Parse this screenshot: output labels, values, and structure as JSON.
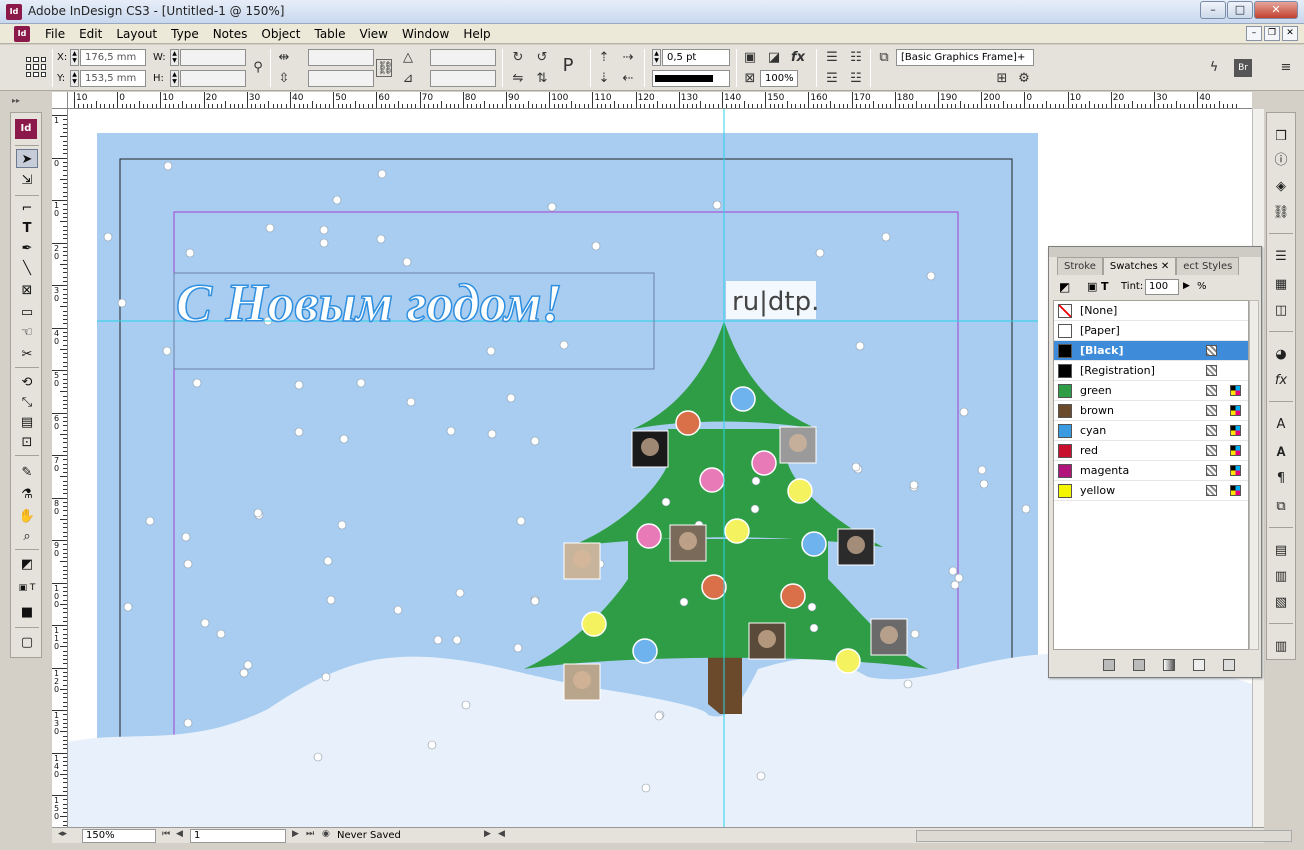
{
  "window": {
    "title": "Adobe InDesign CS3 - [Untitled-1 @ 150%]",
    "app_icon": "Id",
    "min_label": "–",
    "max_label": "□",
    "close_label": "✕"
  },
  "menubar": {
    "items": [
      "File",
      "Edit",
      "Layout",
      "Type",
      "Notes",
      "Object",
      "Table",
      "View",
      "Window",
      "Help"
    ],
    "doc_min": "–",
    "doc_restore": "❐",
    "doc_close": "✕"
  },
  "control": {
    "x_label": "X:",
    "x_value": "176,5 mm",
    "y_label": "Y:",
    "y_value": "153,5 mm",
    "w_label": "W:",
    "w_value": "",
    "h_label": "H:",
    "h_value": "",
    "stroke_weight": "0,5 pt",
    "zoom_percent": "100%",
    "object_style": "[Basic Graphics Frame]+"
  },
  "rulers": {
    "h_labels": [
      "10",
      "0",
      "10",
      "20",
      "30",
      "40",
      "50",
      "60",
      "70",
      "80",
      "90",
      "100",
      "110",
      "120",
      "130",
      "140",
      "150",
      "160",
      "170",
      "180",
      "190",
      "200",
      "0",
      "10",
      "20",
      "30",
      "40"
    ],
    "v_labels": [
      "1",
      "0",
      "1 0",
      "2 0",
      "3 0",
      "4 0",
      "5 0",
      "6 0",
      "7 0",
      "8 0",
      "9 0",
      "1 0 0",
      "1 1 0",
      "1 2 0",
      "1 3 0",
      "1 4 0",
      "1 5 0"
    ]
  },
  "document": {
    "headline": "С Новым годом!",
    "logo_text": "ru|dtp."
  },
  "swatches_panel": {
    "tabs": [
      "Stroke",
      "Swatches",
      "ect Styles"
    ],
    "close_label": "✕",
    "tint_label": "Tint:",
    "tint_value": "100",
    "tint_unit": "%",
    "items": [
      {
        "name": "[None]",
        "color": "#ffffff",
        "selected": false
      },
      {
        "name": "[Paper]",
        "color": "#ffffff",
        "selected": false
      },
      {
        "name": "[Black]",
        "color": "#000000",
        "selected": true
      },
      {
        "name": "[Registration]",
        "color": "#000000",
        "selected": false
      },
      {
        "name": "green",
        "color": "#2e9d45",
        "selected": false
      },
      {
        "name": "brown",
        "color": "#6b4a2c",
        "selected": false
      },
      {
        "name": "cyan",
        "color": "#3a9be0",
        "selected": false
      },
      {
        "name": "red",
        "color": "#c8102e",
        "selected": false
      },
      {
        "name": "magenta",
        "color": "#b0147a",
        "selected": false
      },
      {
        "name": "yellow",
        "color": "#f5f500",
        "selected": false
      }
    ]
  },
  "statusbar": {
    "zoom": "150%",
    "page": "1",
    "save_status": "Never Saved"
  },
  "colors": {
    "sky": "#a8cdf0",
    "snow": "#e8f1fb",
    "tree": "#2e9d45",
    "trunk": "#6b4a2c",
    "guide": "#8a2be2",
    "selection": "#3d8bd9"
  }
}
